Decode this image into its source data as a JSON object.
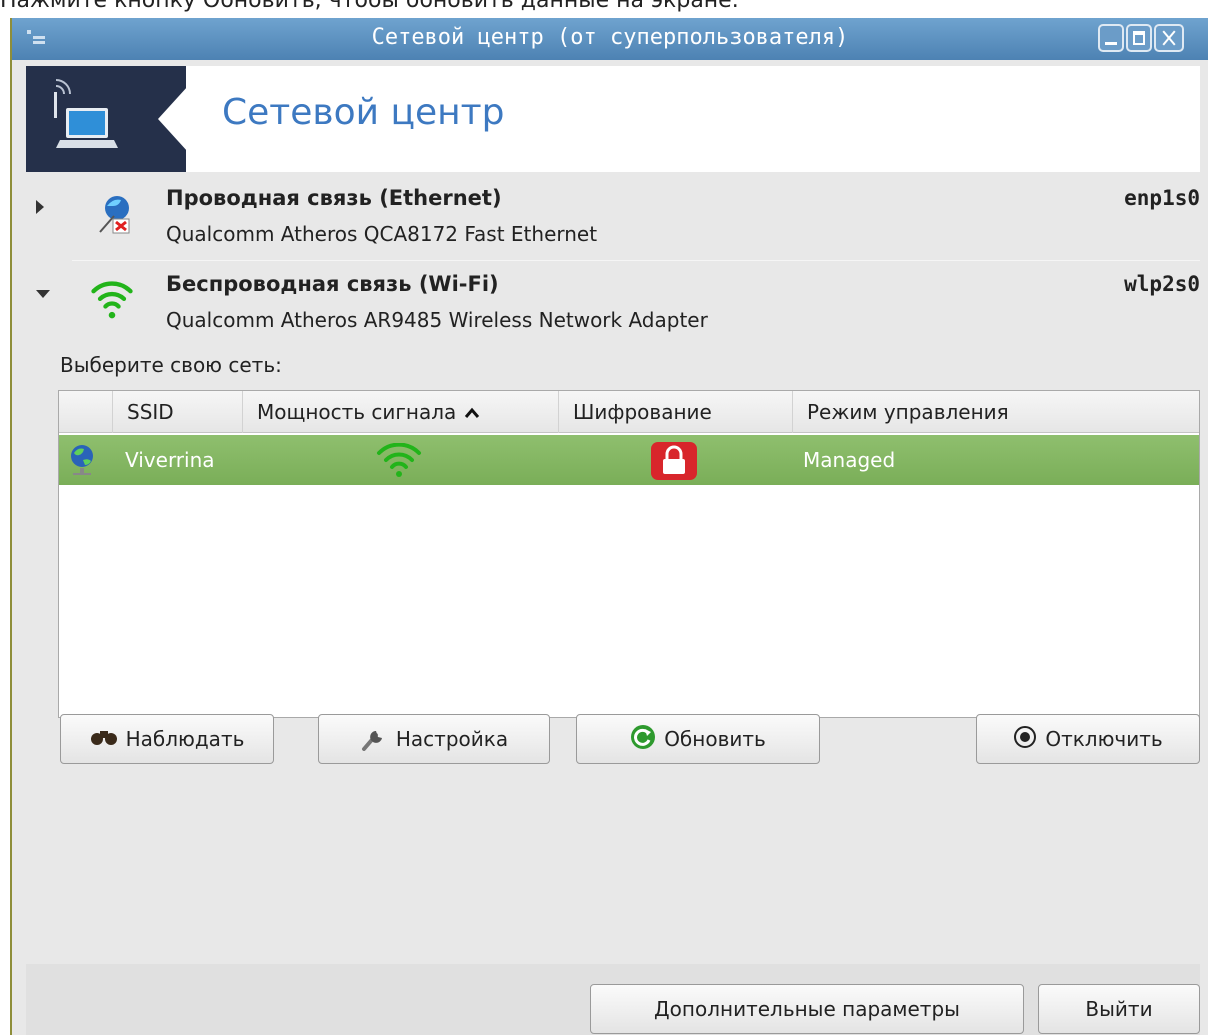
{
  "caption": "Нажмите кнопку Обновить, чтобы обновить данные на экране.",
  "window": {
    "title": "Сетевой центр (от суперпользователя)"
  },
  "banner": {
    "title": "Сетевой центр"
  },
  "interfaces": [
    {
      "name": "Проводная связь (Ethernet)",
      "description": "Qualcomm Atheros QCA8172 Fast Ethernet",
      "device": "enp1s0",
      "expanded": false,
      "icon": "ethernet-disconnected-icon"
    },
    {
      "name": "Беспроводная связь (Wi-Fi)",
      "description": "Qualcomm Atheros AR9485 Wireless Network Adapter",
      "device": "wlp2s0",
      "expanded": true,
      "icon": "wifi-icon"
    }
  ],
  "networks": {
    "prompt": "Выберите свою сеть:",
    "columns": [
      "SSID",
      "Мощность сигнала",
      "Шифрование",
      "Режим управления"
    ],
    "sort_indicator": "⌃",
    "rows": [
      {
        "ssid": "Viverrina",
        "signal": "strong",
        "encrypted": true,
        "mode": "Managed",
        "selected": true
      }
    ]
  },
  "actions": {
    "monitor": "Наблюдать",
    "configure": "Настройка",
    "refresh": "Обновить",
    "disconnect": "Отключить"
  },
  "footer": {
    "advanced": "Дополнительные параметры",
    "quit": "Выйти"
  },
  "colors": {
    "titlebar": "#5b8fbf",
    "banner_dark": "#25304a",
    "banner_title": "#3d79c1",
    "selected_row": "#86b864",
    "wifi_green": "#22b41a",
    "lock_red": "#d8262b"
  }
}
